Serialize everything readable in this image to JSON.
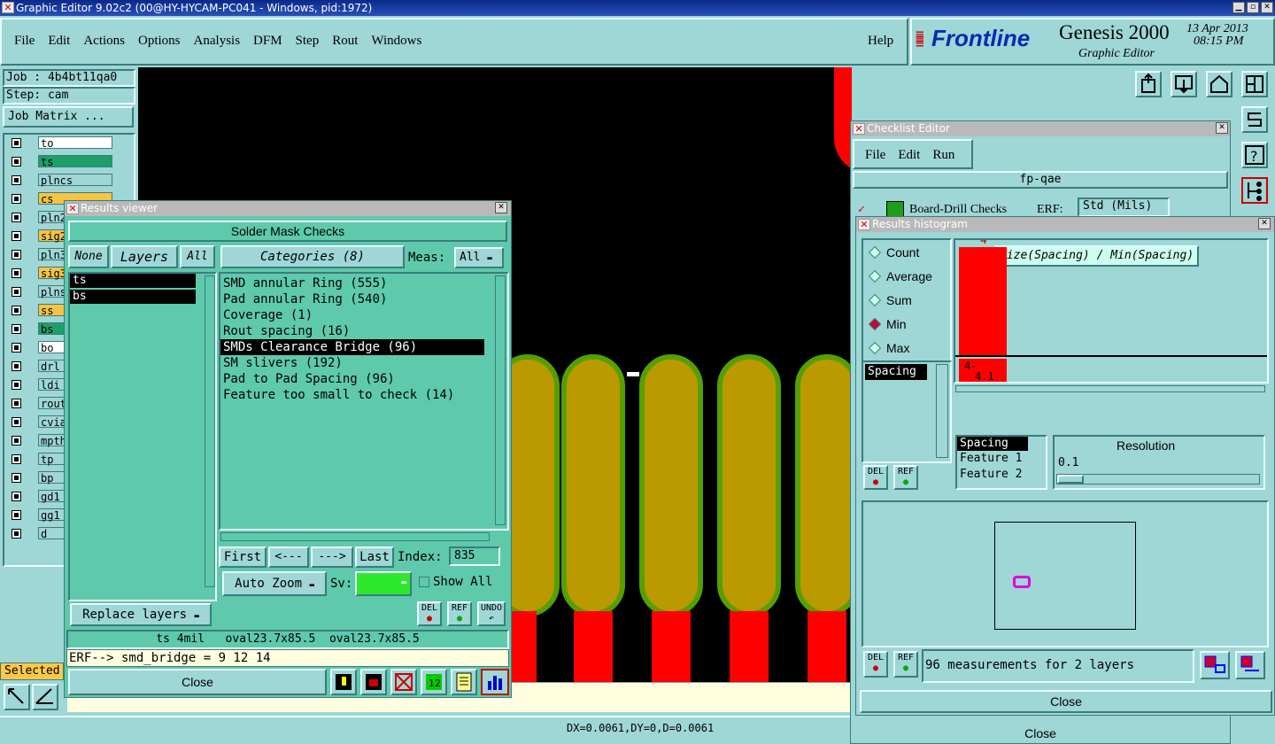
{
  "app": {
    "title": "Graphic Editor 9.02c2 (00@HY-HYCAM-PC041 - Windows, pid:1972)"
  },
  "menu": [
    "File",
    "Edit",
    "Actions",
    "Options",
    "Analysis",
    "DFM",
    "Step",
    "Rout",
    "Windows"
  ],
  "help": "Help",
  "brand": {
    "logo": "Frontline",
    "product": "Genesis 2000",
    "subtitle": "Graphic Editor",
    "date": "13 Apr 2013",
    "time": "08:15 PM"
  },
  "job": {
    "job": "Job : 4b4bt11qa0",
    "step": "Step: cam",
    "matrix": "Job Matrix ..."
  },
  "layers": [
    {
      "name": "to",
      "color": "#ffffff"
    },
    {
      "name": "ts",
      "color": "#1e9e6a"
    },
    {
      "name": "plncs",
      "color": "#9fd6d6"
    },
    {
      "name": "cs",
      "color": "#f5c442"
    },
    {
      "name": "pln2",
      "color": "#9fd6d6"
    },
    {
      "name": "sig2",
      "color": "#f5c442"
    },
    {
      "name": "pln3",
      "color": "#9fd6d6"
    },
    {
      "name": "sig3",
      "color": "#f5c442"
    },
    {
      "name": "plns",
      "color": "#9fd6d6"
    },
    {
      "name": "ss",
      "color": "#f5c442"
    },
    {
      "name": "bs",
      "color": "#1e9e6a"
    },
    {
      "name": "bo",
      "color": "#ffffff"
    },
    {
      "name": "drl",
      "color": "#9fd6d6"
    },
    {
      "name": "ldi",
      "color": "#9fd6d6"
    },
    {
      "name": "rout",
      "color": "#9fd6d6"
    },
    {
      "name": "cvia",
      "color": "#9fd6d6"
    },
    {
      "name": "mpth",
      "color": "#9fd6d6"
    },
    {
      "name": "tp",
      "color": "#9fd6d6"
    },
    {
      "name": "bp",
      "color": "#9fd6d6"
    },
    {
      "name": "gd1",
      "color": "#9fd6d6"
    },
    {
      "name": "gg1",
      "color": "#9fd6d6"
    },
    {
      "name": "d",
      "color": "#9fd6d6"
    }
  ],
  "selected_label": "Selected",
  "status": {
    "coords": "DX=0.0061,DY=0,D=0.0061"
  },
  "results": {
    "title": "Results viewer",
    "header": "Solder Mask Checks",
    "none": "None",
    "layers": "Layers",
    "all": "All",
    "categories": "Categories (8)",
    "meas_label": "Meas:",
    "meas_value": "All",
    "layer_items": [
      "ts",
      "bs"
    ],
    "items": [
      "SMD annular Ring (555)",
      "Pad annular Ring (540)",
      "Coverage (1)",
      "Rout spacing (16)",
      "SMDs Clearance Bridge (96)",
      "SM slivers (192)",
      "Pad to Pad Spacing (96)",
      "Feature too small to check (14)"
    ],
    "selected_index": 4,
    "first": "First",
    "prev": "<---",
    "next": "--->",
    "last": "Last",
    "index_label": "Index:",
    "index_value": "835",
    "autozoom": "Auto Zoom",
    "sv": "Sv:",
    "showall": "Show All",
    "replace": "Replace layers",
    "del": "DEL",
    "ref": "REF",
    "undo": "UNDO",
    "info": "ts 4mil   oval23.7x85.5  oval23.7x85.5",
    "erf": "ERF--> smd_bridge = 9 12 14",
    "close": "Close"
  },
  "checklist": {
    "title": "Checklist Editor",
    "menu": [
      "File",
      "Edit",
      "Run"
    ],
    "name": "fp-qae",
    "row": "Board-Drill Checks",
    "erf": "ERF:",
    "erf_value": "Std (Mils)",
    "close": "Close"
  },
  "histogram": {
    "title": "Results histogram",
    "options": [
      "Count",
      "Average",
      "Sum",
      "Min",
      "Max"
    ],
    "selected": "Min",
    "chart_title": "Size(Spacing) / Min(Spacing)",
    "list": [
      "Spacing"
    ],
    "list2": [
      "Spacing",
      "Feature 1",
      "Feature 2"
    ],
    "resolution_label": "Resolution",
    "resolution": "0.1",
    "measurements": "96 measurements for 2 layers",
    "close": "Close",
    "del": "DEL",
    "ref": "REF"
  },
  "chart_data": {
    "type": "bar",
    "categories": [
      "4-\n4.1"
    ],
    "values": [
      4
    ],
    "title": "Size(Spacing) / Min(Spacing)"
  }
}
